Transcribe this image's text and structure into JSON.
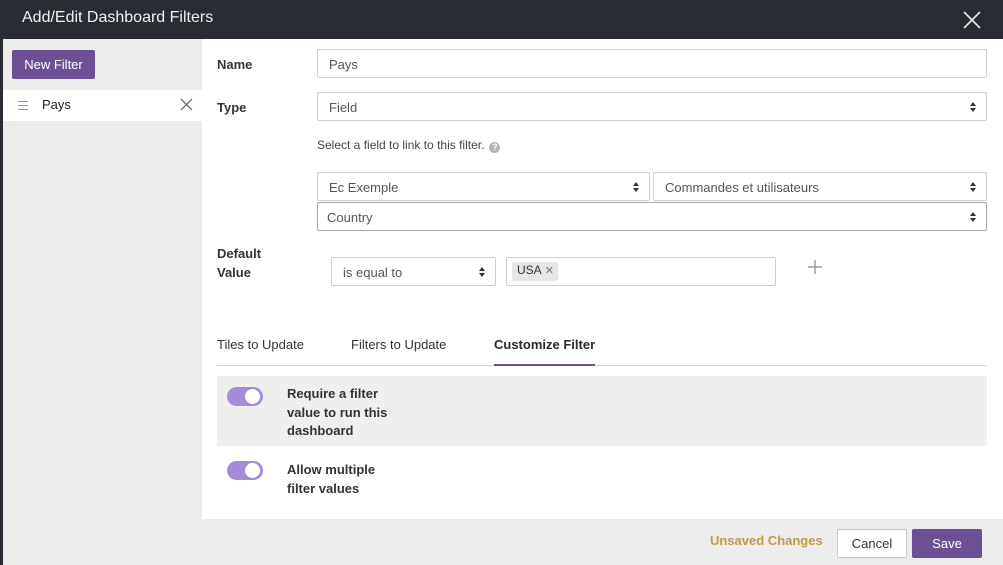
{
  "dialog": {
    "title": "Add/Edit Dashboard Filters"
  },
  "sidebar": {
    "new_filter_label": "New Filter",
    "filters": [
      {
        "label": "Pays"
      }
    ]
  },
  "form": {
    "name_label": "Name",
    "name_value": "Pays",
    "type_label": "Type",
    "type_value": "Field",
    "field_hint": "Select a field to link to this filter.",
    "model_value": "Ec Exemple",
    "explore_value": "Commandes et utilisateurs",
    "field_value": "Country",
    "default_value_label_1": "Default",
    "default_value_label_2": "Value",
    "operator_value": "is equal to",
    "chips": [
      "USA"
    ]
  },
  "tabs": [
    {
      "label": "Tiles to Update",
      "active": false
    },
    {
      "label": "Filters to Update",
      "active": false
    },
    {
      "label": "Customize Filter",
      "active": true
    }
  ],
  "options": [
    {
      "lines": [
        "Require a filter",
        "value to run this",
        "dashboard"
      ],
      "enabled": true
    },
    {
      "lines": [
        "Allow multiple",
        "filter values"
      ],
      "enabled": true
    }
  ],
  "footer": {
    "status": "Unsaved Changes",
    "cancel_label": "Cancel",
    "save_label": "Save"
  },
  "colors": {
    "accent": "#6c4f94",
    "toggle_on": "#a48cd8",
    "titlebar": "#2a2c33",
    "status_warning": "#c59a45"
  },
  "icons": {
    "close": "close-icon",
    "drag": "drag-handle-icon",
    "remove": "remove-icon",
    "help": "help-icon",
    "add": "plus-icon"
  }
}
